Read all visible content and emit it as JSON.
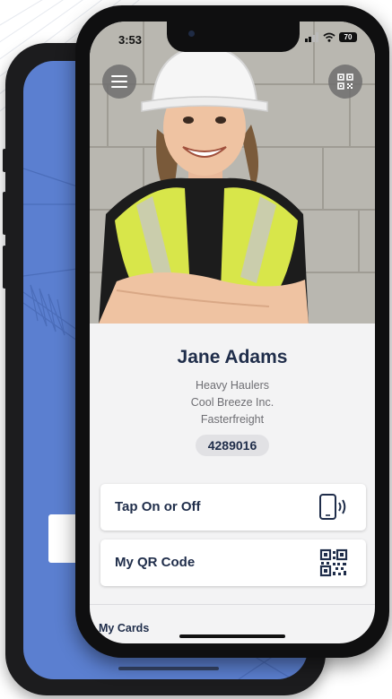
{
  "status_bar": {
    "time": "3:53",
    "battery": "70"
  },
  "profile": {
    "name": "Jane Adams",
    "companies": [
      "Heavy Haulers",
      "Cool Breeze Inc.",
      "Fasterfreight"
    ],
    "id_number": "4289016"
  },
  "actions": [
    {
      "label": "Tap On or Off",
      "icon": "phone-nfc-icon"
    },
    {
      "label": "My QR Code",
      "icon": "qr-code-icon"
    }
  ],
  "footer": {
    "my_cards_label": "My Cards"
  },
  "colors": {
    "navy_text": "#1f2d4a",
    "back_screen_blue": "#5b7fd0",
    "vest_yellow": "#d8e64a"
  }
}
